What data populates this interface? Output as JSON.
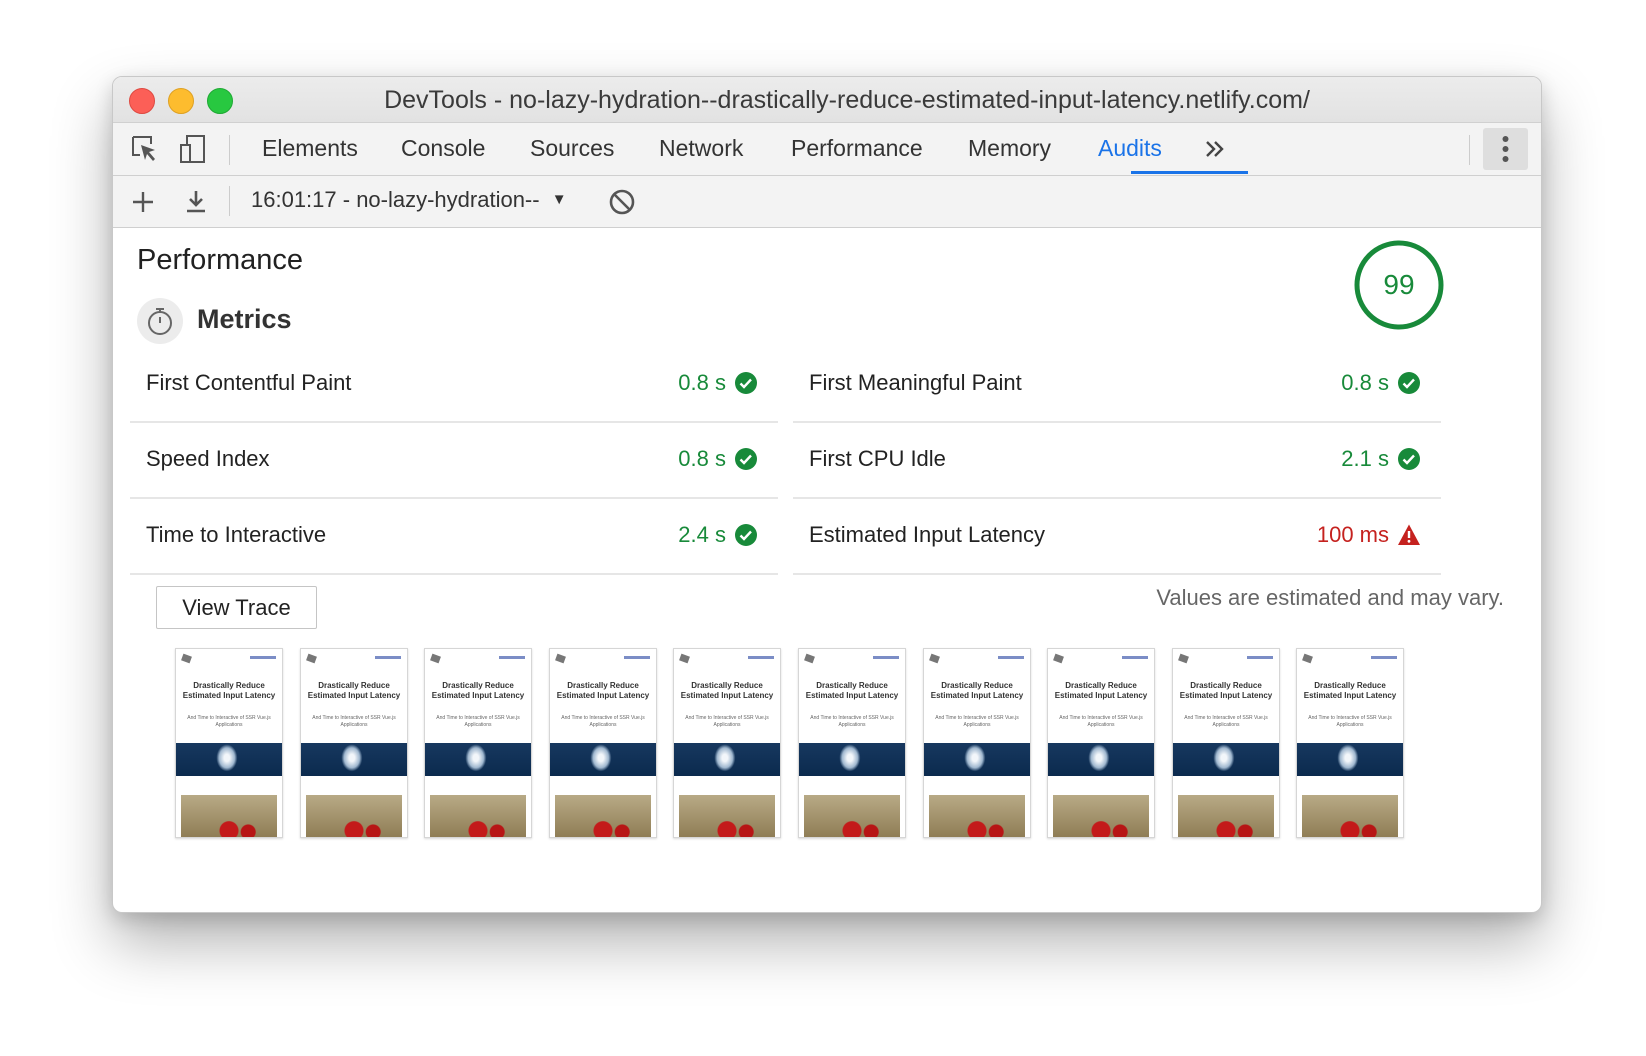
{
  "window": {
    "title": "DevTools - no-lazy-hydration--drastically-reduce-estimated-input-latency.netlify.com/"
  },
  "tabs": [
    {
      "label": "Elements"
    },
    {
      "label": "Console"
    },
    {
      "label": "Sources"
    },
    {
      "label": "Network"
    },
    {
      "label": "Performance"
    },
    {
      "label": "Memory"
    },
    {
      "label": "Audits",
      "active": true
    }
  ],
  "toolbar": {
    "report_select": "16:01:17 - no-lazy-hydration--"
  },
  "report": {
    "category_title": "Performance",
    "score": "99",
    "score_color": "#188a3a",
    "metrics_heading": "Metrics",
    "metrics": [
      {
        "name": "First Contentful Paint",
        "value": "0.8 s",
        "status": "pass"
      },
      {
        "name": "First Meaningful Paint",
        "value": "0.8 s",
        "status": "pass"
      },
      {
        "name": "Speed Index",
        "value": "0.8 s",
        "status": "pass"
      },
      {
        "name": "First CPU Idle",
        "value": "2.1 s",
        "status": "pass"
      },
      {
        "name": "Time to Interactive",
        "value": "2.4 s",
        "status": "pass"
      },
      {
        "name": "Estimated Input Latency",
        "value": "100 ms",
        "status": "fail"
      }
    ],
    "view_trace_label": "View Trace",
    "estimate_note": "Values are estimated and may vary.",
    "filmstrip": {
      "frame_title": "Drastically Reduce Estimated Input Latency",
      "frame_subtitle": "And Time to Interactive of SSR Vue.js Applications",
      "count": 10
    }
  },
  "colors": {
    "pass": "#188a3a",
    "fail": "#c5221f",
    "accent": "#1a73e8"
  }
}
